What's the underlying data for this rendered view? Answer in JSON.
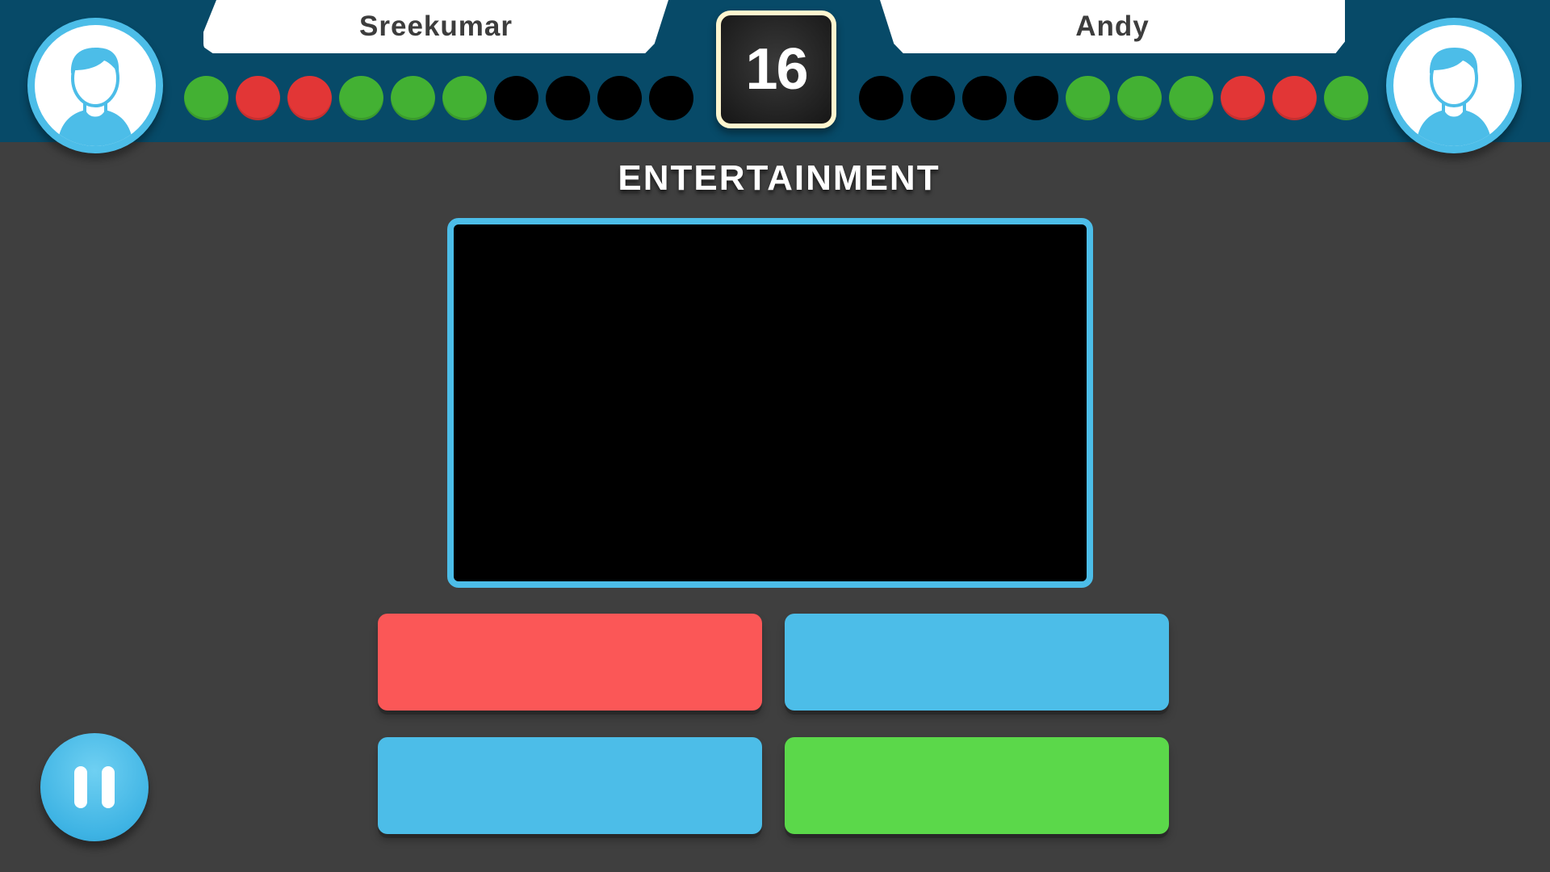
{
  "header": {
    "player_left": {
      "name": "Sreekumar",
      "results": [
        "correct",
        "wrong",
        "wrong",
        "correct",
        "correct",
        "correct",
        "pending",
        "pending",
        "pending",
        "pending"
      ]
    },
    "player_right": {
      "name": "Andy",
      "results": [
        "pending",
        "pending",
        "pending",
        "pending",
        "correct",
        "correct",
        "correct",
        "wrong",
        "wrong",
        "correct"
      ]
    },
    "timer": "16"
  },
  "category": "ENTERTAINMENT",
  "answers": [
    {
      "id": "a",
      "color": "#fb5757"
    },
    {
      "id": "b",
      "color": "#4cbde8"
    },
    {
      "id": "c",
      "color": "#4cbde8"
    },
    {
      "id": "d",
      "color": "#5bd84a"
    }
  ],
  "colors": {
    "correct": "#43b133",
    "wrong": "#e23636",
    "pending": "#000000",
    "header_bg": "#074a68",
    "accent": "#4cbde8",
    "background": "#3f3f3f"
  },
  "icons": {
    "avatar": "user-avatar-icon",
    "pause": "pause-icon"
  }
}
